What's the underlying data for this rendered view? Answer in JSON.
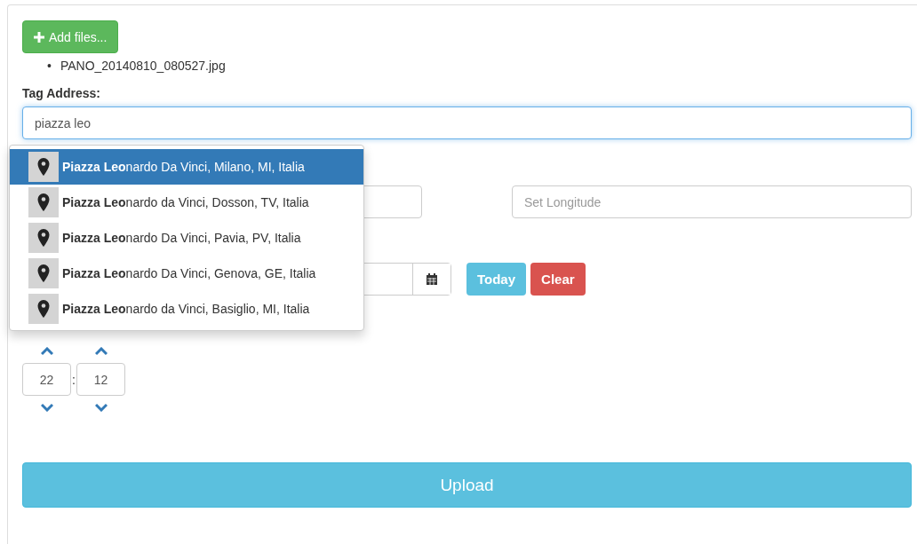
{
  "add_files_button": {
    "label": "Add files..."
  },
  "files": [
    {
      "bullet": "•",
      "name": "PANO_20140810_080527.jpg"
    }
  ],
  "tag_address": {
    "label": "Tag Address:",
    "value": "piazza leo"
  },
  "suggestions": [
    {
      "text": "**Piazza Leo**nardo Da Vinci, Milano, MI, Italia",
      "selected": true
    },
    {
      "text": "**Piazza Leo**nardo da Vinci, Dosson, TV, Italia",
      "selected": false
    },
    {
      "text": "**Piazza Leo**nardo Da Vinci, Pavia, PV, Italia",
      "selected": false
    },
    {
      "text": "**Piazza Leo**nardo Da Vinci, Genova, GE, Italia",
      "selected": false
    },
    {
      "text": "**Piazza Leo**nardo da Vinci, Basiglio, MI, Italia",
      "selected": false
    }
  ],
  "longitude": {
    "placeholder": "Set Longitude"
  },
  "date_buttons": [
    {
      "label": "Today",
      "kind": "info"
    },
    {
      "label": "Clear",
      "kind": "danger"
    }
  ],
  "time": {
    "hours": "22",
    "separator": ":",
    "minutes": "12"
  },
  "upload_button": {
    "label": "Upload"
  }
}
